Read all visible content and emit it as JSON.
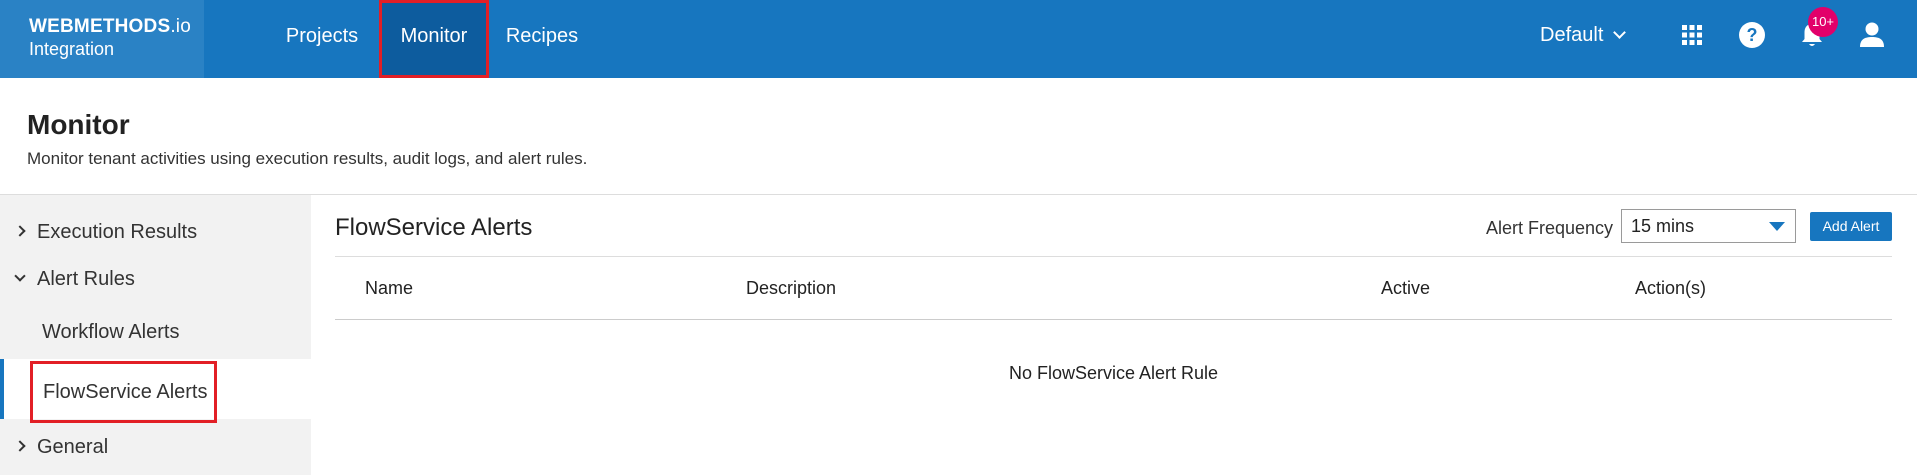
{
  "brand": {
    "name_bold": "WEBMETHODS",
    "name_suffix": ".io",
    "product": "Integration"
  },
  "nav": {
    "items": [
      {
        "label": "Projects",
        "active": false
      },
      {
        "label": "Monitor",
        "active": true
      },
      {
        "label": "Recipes",
        "active": false
      }
    ]
  },
  "topbar": {
    "tenant": "Default",
    "notification_count": "10+",
    "icons": [
      "apps-grid-icon",
      "help-icon",
      "bell-icon",
      "user-icon"
    ],
    "colors": {
      "bar": "#1776bf",
      "active_nav": "#0d5c9e",
      "badge": "#e2006a",
      "highlight": "#e21f26"
    }
  },
  "page": {
    "title": "Monitor",
    "subtitle": "Monitor tenant activities using execution results, audit logs, and alert rules."
  },
  "sidebar": {
    "items": [
      {
        "label": "Execution Results",
        "expanded": false
      },
      {
        "label": "Alert Rules",
        "expanded": true
      },
      {
        "label": "Workflow Alerts"
      },
      {
        "label": "FlowService Alerts",
        "selected": true
      },
      {
        "label": "General",
        "expanded": false
      }
    ]
  },
  "content": {
    "title": "FlowService Alerts",
    "frequency_label": "Alert Frequency",
    "frequency_value": "15 mins",
    "add_button": "Add Alert",
    "columns": [
      "Name",
      "Description",
      "Active",
      "Action(s)"
    ],
    "empty_message": "No FlowService Alert Rule"
  }
}
